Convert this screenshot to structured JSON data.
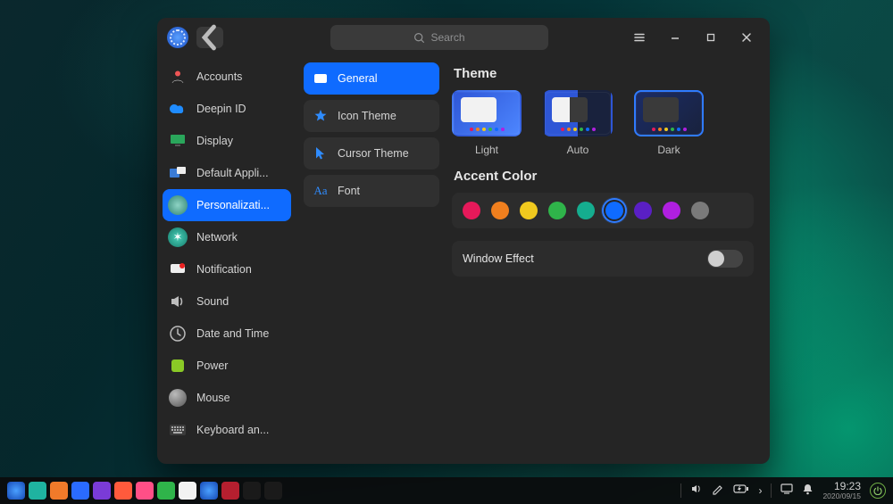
{
  "search": {
    "placeholder": "Search"
  },
  "sidebar": {
    "items": [
      {
        "label": "Accounts",
        "icon": "accounts"
      },
      {
        "label": "Deepin ID",
        "icon": "cloud"
      },
      {
        "label": "Display",
        "icon": "display"
      },
      {
        "label": "Default Appli...",
        "icon": "default-apps"
      },
      {
        "label": "Personalizati...",
        "icon": "personalize",
        "selected": true
      },
      {
        "label": "Network",
        "icon": "network"
      },
      {
        "label": "Notification",
        "icon": "notification"
      },
      {
        "label": "Sound",
        "icon": "sound"
      },
      {
        "label": "Date and Time",
        "icon": "time"
      },
      {
        "label": "Power",
        "icon": "power"
      },
      {
        "label": "Mouse",
        "icon": "mouse"
      },
      {
        "label": "Keyboard an...",
        "icon": "keyboard"
      }
    ]
  },
  "subtabs": [
    {
      "label": "General",
      "icon": "general",
      "selected": true
    },
    {
      "label": "Icon Theme",
      "icon": "icon-theme"
    },
    {
      "label": "Cursor Theme",
      "icon": "cursor-theme"
    },
    {
      "label": "Font",
      "icon": "font"
    }
  ],
  "content": {
    "theme_heading": "Theme",
    "themes": [
      {
        "label": "Light",
        "variant": "light"
      },
      {
        "label": "Auto",
        "variant": "auto"
      },
      {
        "label": "Dark",
        "variant": "dark",
        "selected": true
      }
    ],
    "accent_heading": "Accent Color",
    "accent_colors": [
      {
        "hex": "#e6195a"
      },
      {
        "hex": "#f07f1e"
      },
      {
        "hex": "#f0c91e"
      },
      {
        "hex": "#2fb44a"
      },
      {
        "hex": "#15ad8f"
      },
      {
        "hex": "#0f6bff",
        "selected": true
      },
      {
        "hex": "#5a1fc4"
      },
      {
        "hex": "#b01fe0"
      },
      {
        "hex": "#7a7a7a"
      }
    ],
    "window_effect_label": "Window Effect",
    "window_effect_on": false
  },
  "taskbar": {
    "apps": [
      {
        "name": "launcher",
        "bg": "radial-gradient(circle,#4aa0ff,#1649b5)"
      },
      {
        "name": "multitask",
        "bg": "#1fb3a0"
      },
      {
        "name": "files",
        "bg": "#f07a2a"
      },
      {
        "name": "app-store",
        "bg": "#2a6bff"
      },
      {
        "name": "browser",
        "bg": "#7a3bd7"
      },
      {
        "name": "mail",
        "bg": "#ff5a3c"
      },
      {
        "name": "photos",
        "bg": "#ff4f87"
      },
      {
        "name": "music",
        "bg": "#2fb44a"
      },
      {
        "name": "calendar",
        "bg": "#f2f2f2"
      },
      {
        "name": "settings",
        "bg": "radial-gradient(circle,#4aa0ff,#1649b5)"
      },
      {
        "name": "terminal",
        "bg": "#b51f2f"
      },
      {
        "name": "system-monitor",
        "bg": "#1a1a1a"
      },
      {
        "name": "more",
        "bg": "#1a1a1a"
      }
    ],
    "time": "19:23",
    "date": "2020/09/15"
  }
}
